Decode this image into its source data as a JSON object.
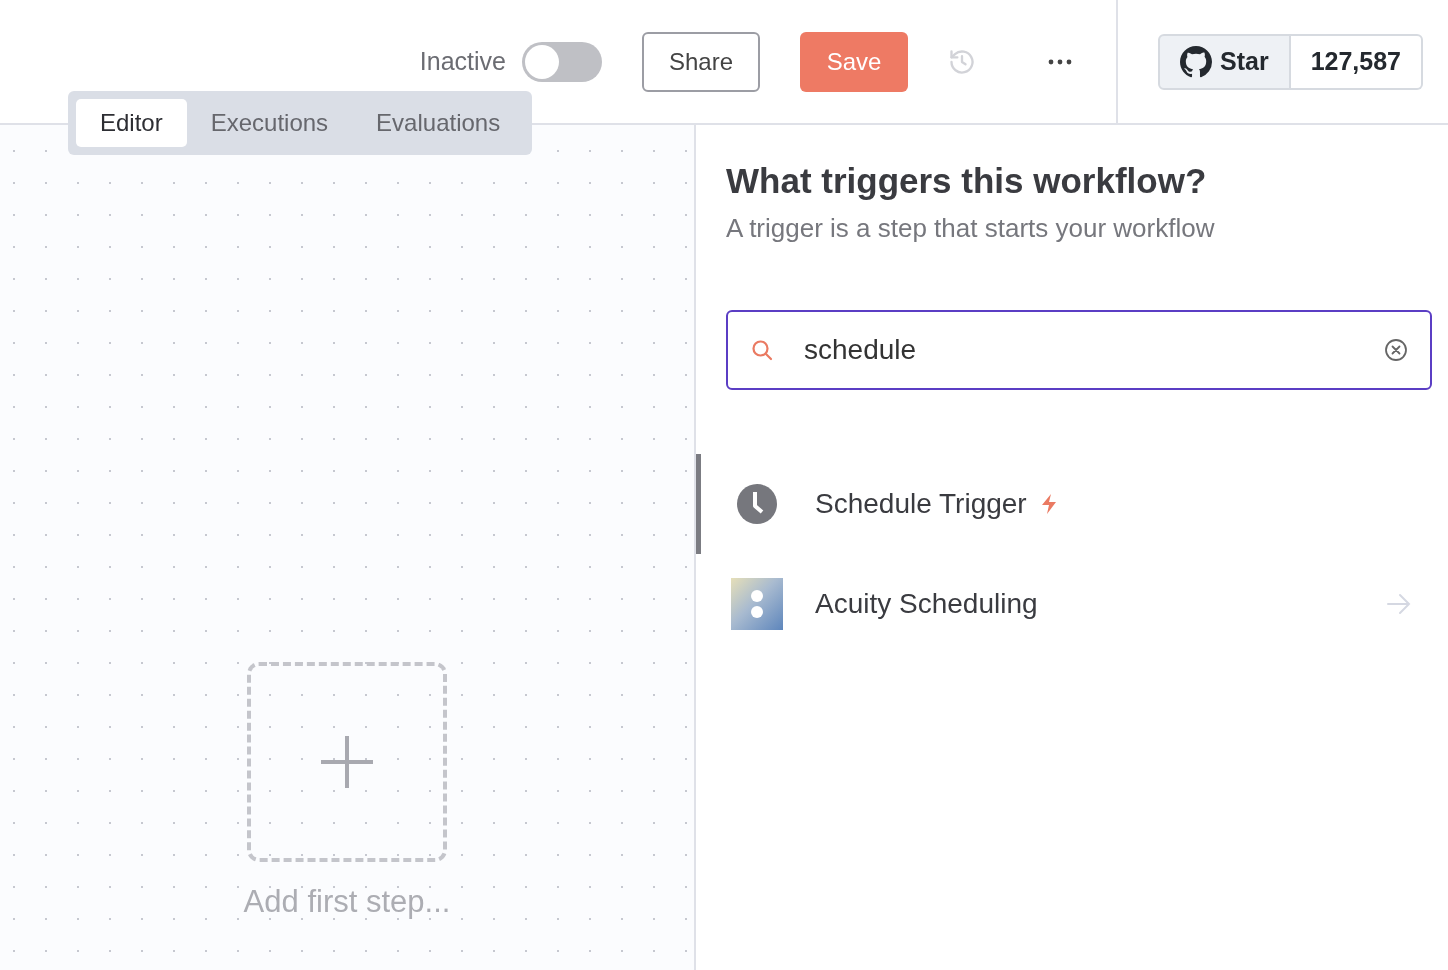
{
  "header": {
    "status_label": "Inactive",
    "active": false,
    "share_button": "Share",
    "save_button": "Save",
    "github": {
      "star_label": "Star",
      "star_count": "127,587"
    }
  },
  "tabs": [
    {
      "label": "Editor",
      "selected": true
    },
    {
      "label": "Executions",
      "selected": false
    },
    {
      "label": "Evaluations",
      "selected": false
    }
  ],
  "canvas": {
    "add_step_label": "Add first step..."
  },
  "panel": {
    "title": "What triggers this workflow?",
    "subtitle": "A trigger is a step that starts your workflow",
    "search": {
      "value": "schedule"
    },
    "results": [
      {
        "name": "Schedule Trigger",
        "kind": "trigger",
        "selected": true
      },
      {
        "name": "Acuity Scheduling",
        "kind": "app",
        "selected": false
      }
    ]
  }
}
